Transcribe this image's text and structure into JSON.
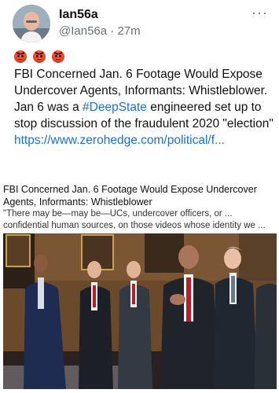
{
  "post": {
    "display_name": "Ian56a",
    "handle": "@Ian56a",
    "separator": "·",
    "time": "27m",
    "more_label": "···",
    "emojis": [
      "angry-face-icon",
      "angry-face-icon",
      "angry-face-icon"
    ],
    "text_line1": "FBI Concerned Jan. 6 Footage Would Expose Undercover Agents, Informants: Whistleblower.",
    "text_jan6_prefix": "Jan 6 was a ",
    "hashtag": "#DeepState",
    "text_jan6_suffix": " engineered set up to stop discussion of the fraudulent 2020 \"election\"",
    "link": "https://www.zerohedge.com/political/f..."
  },
  "link_card": {
    "title": "FBI Concerned Jan. 6 Footage Would Expose Undercover Agents, Informants: Whistleblower",
    "snippet": "\"There may be—may be—UCs, undercover officers, or ... confidential human sources, on those videos whose identity we ..."
  },
  "colors": {
    "accent_link": "#1a73c8",
    "text_primary": "#111111",
    "text_secondary": "#6b6f73"
  }
}
